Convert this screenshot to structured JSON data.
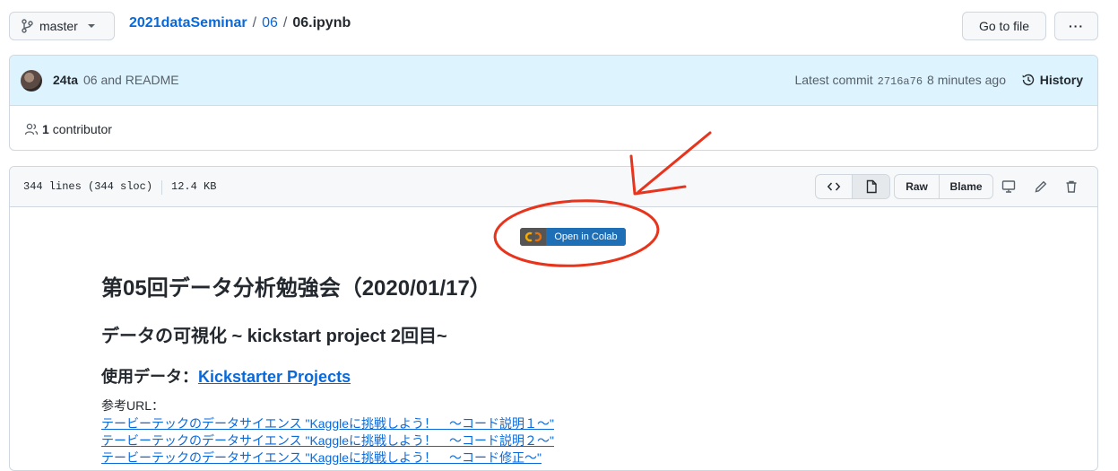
{
  "header": {
    "branch": "master",
    "breadcrumb": {
      "repo": "2021dataSeminar",
      "sep1": "/",
      "folder": "06",
      "sep2": "/",
      "file": "06.ipynb"
    },
    "go_to_file": "Go to file",
    "more": "···"
  },
  "commit": {
    "author": "24ta",
    "message": "06 and README",
    "latest_label": "Latest commit",
    "sha": "2716a76",
    "time": "8 minutes ago",
    "history_label": "History",
    "contributors_count": "1",
    "contributors_label": "contributor"
  },
  "file": {
    "lines": "344 lines (344 sloc)",
    "size": "12.4 KB",
    "raw_label": "Raw",
    "blame_label": "Blame"
  },
  "notebook": {
    "colab_badge": "Open in Colab",
    "title": "第05回データ分析勉強会（2020/01/17）",
    "subtitle": "データの可視化 ~ kickstart project 2回目~",
    "data_label": "使用データ：",
    "data_link": "Kickstarter Projects",
    "ref_label": "参考URL：",
    "refs": [
      "テービーテックのデータサイエンス \"Kaggleに挑戦しよう！　～コード説明１～\"",
      "テービーテックのデータサイエンス \"Kaggleに挑戦しよう！　～コード説明２～\"",
      "テービーテックのデータサイエンス \"Kaggleに挑戦しよう！　～コード修正～\""
    ]
  },
  "colors": {
    "link": "#0969da",
    "annotation": "#e8341c",
    "commit_bg": "#ddf4ff",
    "colab_blue": "#1f6fb7"
  }
}
